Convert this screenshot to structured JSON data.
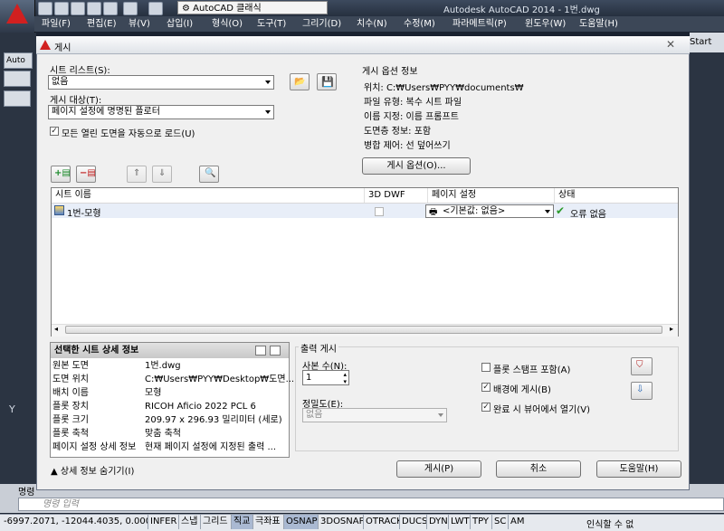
{
  "app": {
    "title": "Autodesk AutoCAD 2014 - 1번.dwg",
    "workspace": "AutoCAD 클래식",
    "menu": [
      "파일(F)",
      "편집(E)",
      "뷰(V)",
      "삽입(I)",
      "형식(O)",
      "도구(T)",
      "그리기(D)",
      "치수(N)",
      "수정(M)",
      "파라메트릭(P)",
      "윈도우(W)",
      "도움말(H)"
    ],
    "left_tab": "Auto",
    "right_tab": "Start",
    "command_label": "명령",
    "command_placeholder": "명령 입력",
    "coords": "-6997.2071, -12044.4035, 0.0000",
    "status_buttons": [
      {
        "label": "INFER",
        "on": false
      },
      {
        "label": "스냅",
        "on": false
      },
      {
        "label": "그리드",
        "on": false
      },
      {
        "label": "직교",
        "on": true
      },
      {
        "label": "극좌표",
        "on": false
      },
      {
        "label": "OSNAP",
        "on": true
      },
      {
        "label": "3DOSNAP",
        "on": false
      },
      {
        "label": "OTRACK",
        "on": false
      },
      {
        "label": "DUCS",
        "on": false
      },
      {
        "label": "DYN",
        "on": false
      },
      {
        "label": "LWT",
        "on": false
      },
      {
        "label": "TPY",
        "on": false
      },
      {
        "label": "SC",
        "on": false
      },
      {
        "label": "AM",
        "on": false
      }
    ],
    "status_right": "인식할 수 없"
  },
  "dialog": {
    "title": "게시",
    "sheet_list_label": "시트 리스트(S):",
    "sheet_list_value": "없음",
    "publish_to_label": "게시 대상(T):",
    "publish_to_value": "페이지 설정에 명명된 플로터",
    "auto_load_label": "모든 열린 도면을 자동으로 로드(U)",
    "auto_load_checked": true,
    "options_title": "게시 옵션 정보",
    "options_lines": [
      "위치: C:₩Users₩PYY₩documents₩",
      "파일 유형: 복수 시트 파일",
      "이름 지정: 이름 프롬프트",
      "도면층 정보: 포함",
      "병합 제어: 선 덮어쓰기"
    ],
    "options_button": "게시 옵션(O)...",
    "columns": [
      "시트 이름",
      "3D DWF",
      "페이지 설정",
      "상태"
    ],
    "rows": [
      {
        "name": "1번-모형",
        "dwf": false,
        "page_setup": "<기본값: 없음>",
        "status": "오류 없음"
      }
    ],
    "details_title": "선택한 시트 상세 정보",
    "details": [
      {
        "k": "원본 도면",
        "v": "1번.dwg"
      },
      {
        "k": "도면 위치",
        "v": "C:₩Users₩PYY₩Desktop₩도면..."
      },
      {
        "k": "배치 이름",
        "v": "모형"
      },
      {
        "k": "플롯 장치",
        "v": "RICOH Aficio 2022 PCL 6"
      },
      {
        "k": "플롯 크기",
        "v": "209.97 x 296.93 밀리미터 (세로)"
      },
      {
        "k": "플롯 축척",
        "v": "맞춤 축척"
      },
      {
        "k": "페이지 설정 상세 정보",
        "v": "현재 페이지 설정에 지정된 출력 ..."
      }
    ],
    "output_title": "출력 게시",
    "copies_label": "사본 수(N):",
    "copies_value": "1",
    "precision_label": "정밀도(E):",
    "precision_value": "없음",
    "stamp_label": "플롯 스탬프 포함(A)",
    "stamp_checked": false,
    "background_label": "배경에 게시(B)",
    "background_checked": true,
    "viewer_label": "완료 시 뷰어에서 열기(V)",
    "viewer_checked": true,
    "hide_details": "상세 정보 숨기기(I)",
    "publish_button": "게시(P)",
    "cancel_button": "취소",
    "help_button": "도움말(H)"
  }
}
